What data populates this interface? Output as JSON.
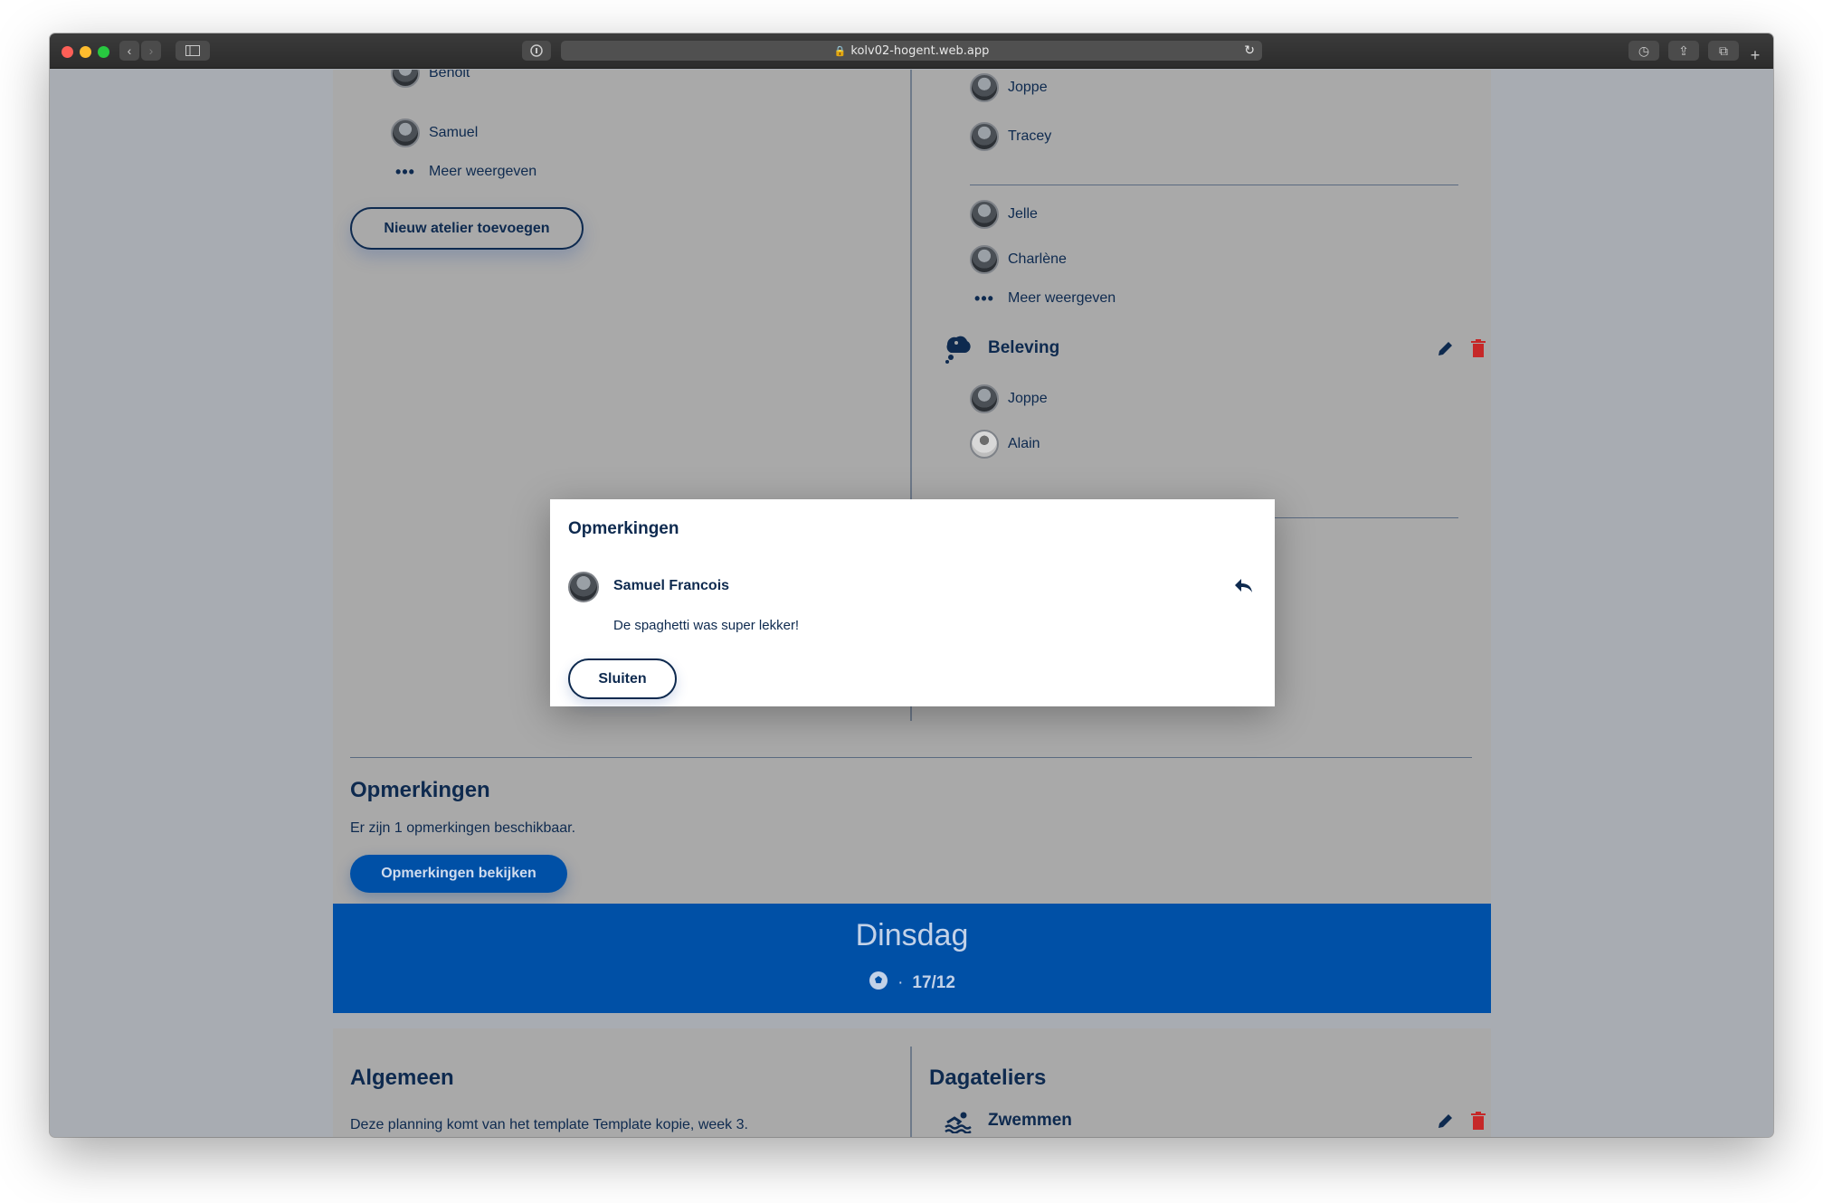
{
  "browser": {
    "url": "kolv02-hogent.web.app"
  },
  "left_column": {
    "members": [
      "Benoit",
      "Samuel"
    ],
    "more_label": "Meer weergeven",
    "add_button": "Nieuw atelier toevoegen"
  },
  "right_column": {
    "group1": [
      "Joppe",
      "Tracey"
    ],
    "group2": [
      "Jelle",
      "Charlène"
    ],
    "more_label": "Meer weergeven",
    "activity": {
      "title": "Beleving",
      "members": [
        "Joppe",
        "Alain"
      ]
    }
  },
  "remarks_section": {
    "title": "Opmerkingen",
    "text": "Er zijn 1 opmerkingen beschikbaar.",
    "button": "Opmerkingen bekijken"
  },
  "day": {
    "name": "Dinsdag",
    "separator": "·",
    "date": "17/12"
  },
  "general": {
    "title": "Algemeen",
    "text": "Deze planning komt van het template Template kopie, week 3."
  },
  "day_workshops": {
    "title": "Dagateliers",
    "item": "Zwemmen"
  },
  "modal": {
    "title": "Opmerkingen",
    "author": "Samuel Francois",
    "message": "De spaghetti was super lekker!",
    "close_button": "Sluiten"
  },
  "colors": {
    "navy": "#0e2a4f",
    "primary": "#0050a6",
    "delete": "#c62828"
  }
}
